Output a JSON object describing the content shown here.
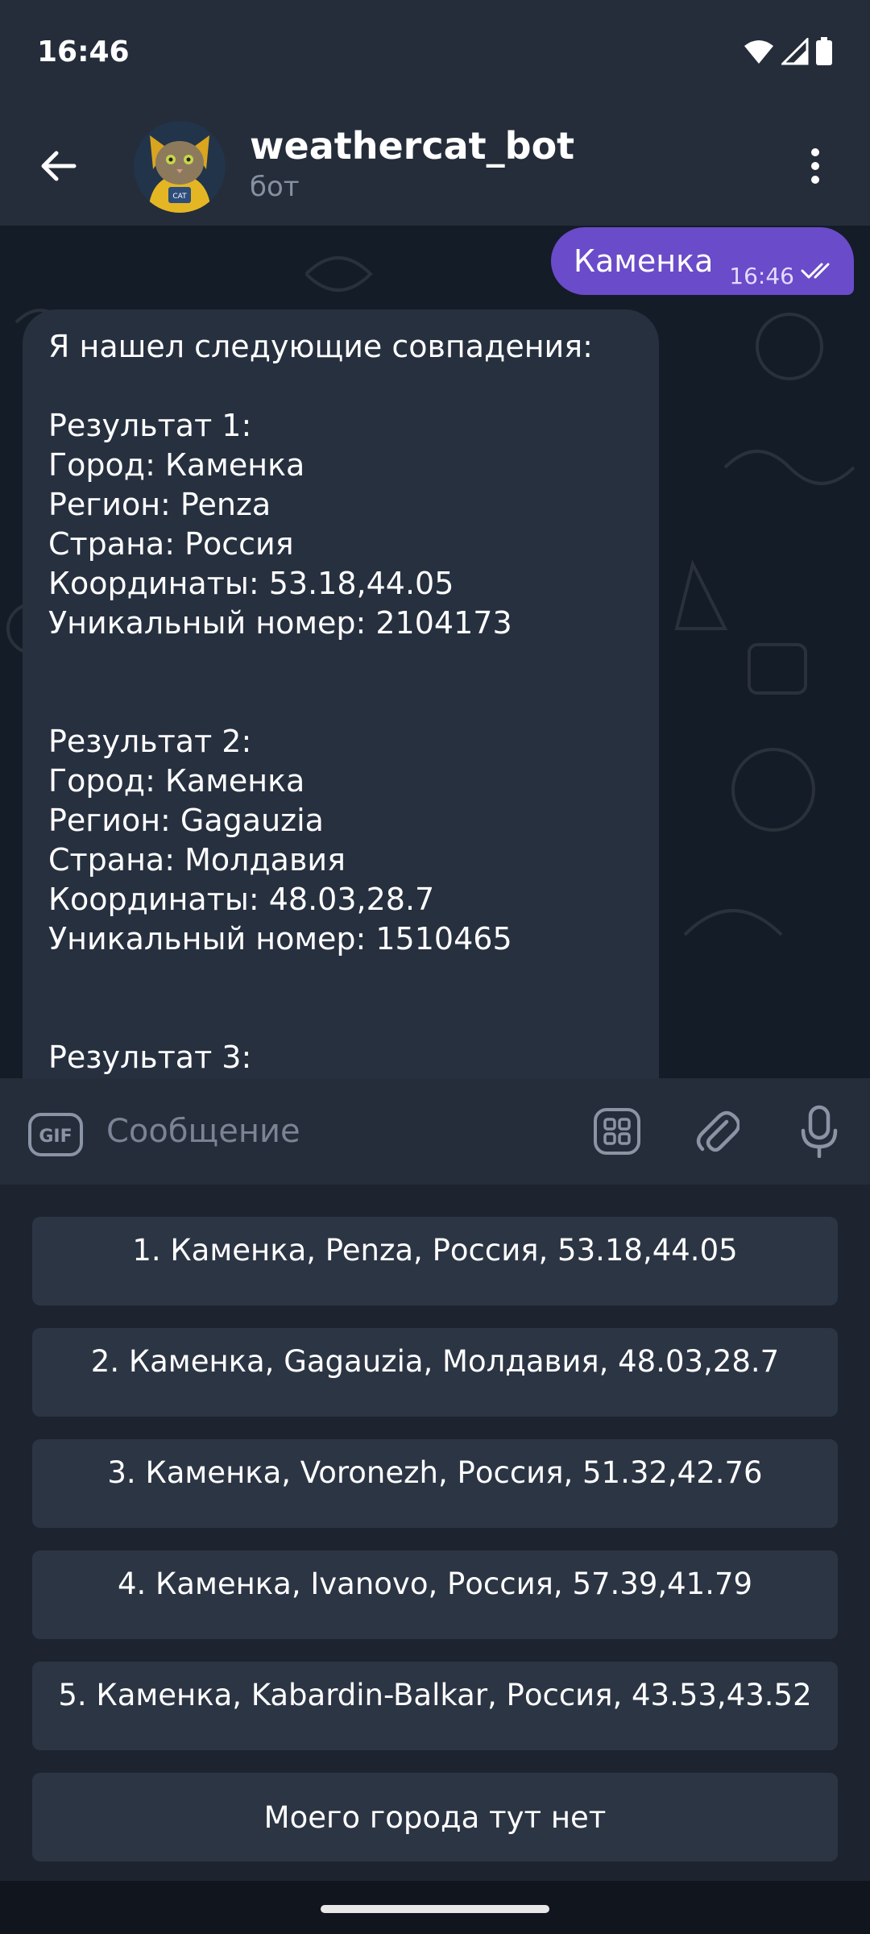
{
  "status_bar": {
    "time": "16:46",
    "icons": [
      "wifi-icon",
      "signal-icon",
      "battery-icon"
    ]
  },
  "header": {
    "title": "weathercat_bot",
    "subtitle": "бот",
    "back_icon": "arrow-left-icon",
    "menu_icon": "more-vertical-icon",
    "avatar_badge": "CAT"
  },
  "messages": {
    "outgoing": {
      "text": "Каменка",
      "time": "16:46",
      "status_icon": "double-check-icon"
    },
    "incoming": {
      "text": "Я нашел следующие совпадения:\n\nРезультат 1:\nГород: Каменка\nРегион: Penza\nСтрана: Россия\nКоординаты: 53.18,44.05\nУникальный номер: 2104173\n\n\nРезультат 2:\nГород: Каменка\nРегион: Gagauzia\nСтрана: Молдавия\nКоординаты: 48.03,28.7\nУникальный номер: 1510465\n\n\nРезультат 3:"
    }
  },
  "input_bar": {
    "placeholder": "Сообщение",
    "gif_label": "GIF",
    "icons": [
      "gif-icon",
      "bot-keyboard-icon",
      "paperclip-icon",
      "microphone-icon"
    ]
  },
  "keyboard_buttons": [
    "1. Каменка, Penza, Россия, 53.18,44.05",
    "2. Каменка, Gagauzia, Молдавия, 48.03,28.7",
    "3. Каменка, Voronezh, Россия, 51.32,42.76",
    "4. Каменка, Ivanovo, Россия, 57.39,41.79",
    "5. Каменка, Kabardin-Balkar, Россия, 43.53,43.52",
    "Моего города тут нет"
  ],
  "colors": {
    "accent_bubble": "#6a4bc9",
    "header_bg": "#252d3a",
    "chat_bg": "#141c27",
    "incoming_bubble": "#27303f",
    "keyboard_button": "#2c3544"
  }
}
